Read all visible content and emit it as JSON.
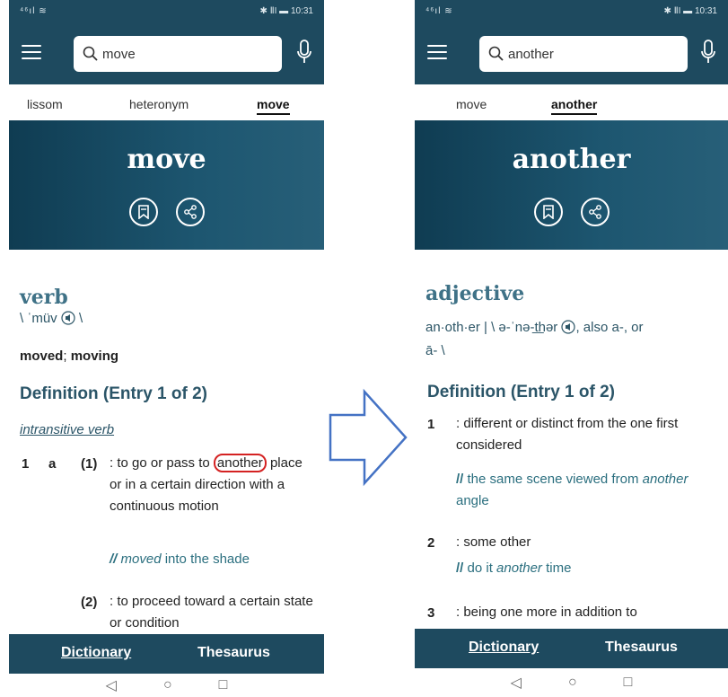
{
  "status": {
    "signal": "⁴⁶ıl ≋",
    "right": "✱ ⅡΙ ▬ 10:31"
  },
  "left": {
    "search_value": "move",
    "tabs": [
      "lissom",
      "heteronym",
      "move"
    ],
    "headword": "move",
    "pos": "verb",
    "pronunciation": "\\ ˈmüv ",
    "pron_end": " \\",
    "forms": {
      "a": "moved",
      "sep": "; ",
      "b": "moving"
    },
    "definition_heading": "Definition (Entry 1 of 2)",
    "verb_type": "intransitive verb",
    "sense1_num": "1",
    "sense1_letter": "a",
    "sense1_sub": "(1)",
    "sense1_text_pre": ": to go or pass to ",
    "sense1_highlight": "another",
    "sense1_text_rest": "place or in a certain direction with a continuous motion",
    "sense1_example_slashes": "//",
    "sense1_example_word": "moved",
    "sense1_example_rest": " into the shade",
    "sense2_sub": "(2)",
    "sense2_text": ": to proceed toward a certain state or condition"
  },
  "right": {
    "search_value": "another",
    "tabs": [
      "move",
      "another"
    ],
    "headword": "another",
    "pos": "adjective",
    "pron_line1": "an·oth·er  |  \\ ə-ˈnə-t͟hər ",
    "pron_line1_end": ", also a-, or",
    "pron_line2": "ā- \\",
    "definition_heading": "Definition (Entry 1 of 2)",
    "senses": [
      {
        "num": "1",
        "text": ": different or distinct from the one first considered",
        "ex_pre": "the same scene viewed from ",
        "ex_word": "another",
        "ex_post": " angle"
      },
      {
        "num": "2",
        "text": ": some other",
        "ex_pre": "do it ",
        "ex_word": "another",
        "ex_post": " time"
      },
      {
        "num": "3",
        "text": ": being one more in addition to"
      }
    ]
  },
  "bottom": {
    "dictionary": "Dictionary",
    "thesaurus": "Thesaurus"
  },
  "nav": {
    "back": "◁",
    "home": "○",
    "recent": "□"
  }
}
